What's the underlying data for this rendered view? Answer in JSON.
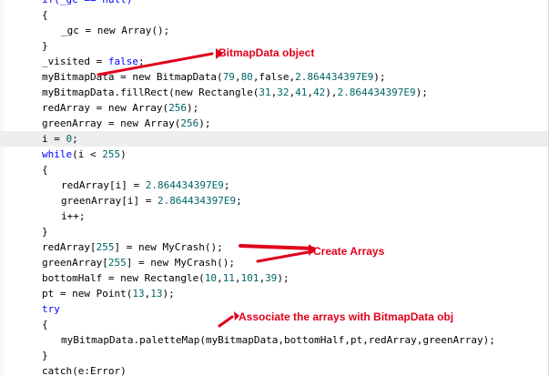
{
  "editor": {
    "lines": [
      {
        "indent": 0,
        "tokens": [
          {
            "t": "if(_gc == null)",
            "c": "kw"
          }
        ]
      },
      {
        "indent": 0,
        "tokens": [
          {
            "t": "{"
          }
        ]
      },
      {
        "indent": 1,
        "tokens": [
          {
            "t": "_gc = new Array();"
          }
        ]
      },
      {
        "indent": 0,
        "tokens": [
          {
            "t": "}"
          }
        ]
      },
      {
        "indent": 0,
        "tokens": [
          {
            "t": "_visited = "
          },
          {
            "t": "false",
            "c": "kw"
          },
          {
            "t": ";"
          }
        ]
      },
      {
        "indent": 0,
        "tokens": [
          {
            "t": "myBitmapData = new BitmapData("
          },
          {
            "t": "79",
            "c": "num"
          },
          {
            "t": ","
          },
          {
            "t": "80",
            "c": "num"
          },
          {
            "t": ",false,"
          },
          {
            "t": "2.864434397E9",
            "c": "num"
          },
          {
            "t": ");"
          }
        ]
      },
      {
        "indent": 0,
        "tokens": [
          {
            "t": "myBitmapData.fillRect(new Rectangle("
          },
          {
            "t": "31",
            "c": "num"
          },
          {
            "t": ","
          },
          {
            "t": "32",
            "c": "num"
          },
          {
            "t": ","
          },
          {
            "t": "41",
            "c": "num"
          },
          {
            "t": ","
          },
          {
            "t": "42",
            "c": "num"
          },
          {
            "t": "),"
          },
          {
            "t": "2.864434397E9",
            "c": "num"
          },
          {
            "t": ");"
          }
        ]
      },
      {
        "indent": 0,
        "tokens": [
          {
            "t": "redArray = new Array("
          },
          {
            "t": "256",
            "c": "num"
          },
          {
            "t": ");"
          }
        ]
      },
      {
        "indent": 0,
        "tokens": [
          {
            "t": "greenArray = new Array("
          },
          {
            "t": "256",
            "c": "num"
          },
          {
            "t": ");"
          }
        ]
      },
      {
        "indent": 0,
        "current": true,
        "tokens": [
          {
            "t": "i = "
          },
          {
            "t": "0",
            "c": "num"
          },
          {
            "t": ";"
          }
        ]
      },
      {
        "indent": 0,
        "tokens": [
          {
            "t": "while",
            "c": "kw"
          },
          {
            "t": "(i < "
          },
          {
            "t": "255",
            "c": "num"
          },
          {
            "t": ")"
          }
        ]
      },
      {
        "indent": 0,
        "tokens": [
          {
            "t": "{"
          }
        ]
      },
      {
        "indent": 1,
        "tokens": [
          {
            "t": "redArray[i] = "
          },
          {
            "t": "2.864434397E9",
            "c": "num"
          },
          {
            "t": ";"
          }
        ]
      },
      {
        "indent": 1,
        "tokens": [
          {
            "t": "greenArray[i] = "
          },
          {
            "t": "2.864434397E9",
            "c": "num"
          },
          {
            "t": ";"
          }
        ]
      },
      {
        "indent": 1,
        "tokens": [
          {
            "t": "i++;"
          }
        ]
      },
      {
        "indent": 0,
        "tokens": [
          {
            "t": "}"
          }
        ]
      },
      {
        "indent": 0,
        "tokens": [
          {
            "t": "redArray["
          },
          {
            "t": "255",
            "c": "num"
          },
          {
            "t": "] = new MyCrash();"
          }
        ]
      },
      {
        "indent": 0,
        "tokens": [
          {
            "t": "greenArray["
          },
          {
            "t": "255",
            "c": "num"
          },
          {
            "t": "] = new MyCrash();"
          }
        ]
      },
      {
        "indent": 0,
        "tokens": [
          {
            "t": "bottomHalf = new Rectangle("
          },
          {
            "t": "10",
            "c": "num"
          },
          {
            "t": ","
          },
          {
            "t": "11",
            "c": "num"
          },
          {
            "t": ","
          },
          {
            "t": "101",
            "c": "num"
          },
          {
            "t": ","
          },
          {
            "t": "39",
            "c": "num"
          },
          {
            "t": ");"
          }
        ]
      },
      {
        "indent": 0,
        "tokens": [
          {
            "t": "pt = new Point("
          },
          {
            "t": "13",
            "c": "num"
          },
          {
            "t": ","
          },
          {
            "t": "13",
            "c": "num"
          },
          {
            "t": ");"
          }
        ]
      },
      {
        "indent": 0,
        "tokens": [
          {
            "t": "try",
            "c": "kw"
          }
        ]
      },
      {
        "indent": 0,
        "tokens": [
          {
            "t": "{"
          }
        ]
      },
      {
        "indent": 1,
        "tokens": [
          {
            "t": "myBitmapData.paletteMap(myBitmapData,bottomHalf,pt,redArray,greenArray);"
          }
        ]
      },
      {
        "indent": 0,
        "tokens": [
          {
            "t": "}"
          }
        ]
      },
      {
        "indent": 0,
        "tokens": [
          {
            "t": "catch(e:Error)"
          }
        ]
      }
    ]
  },
  "annotations": {
    "bitmapdata_label": "BitmapData object",
    "create_arrays_label": "Create Arrays",
    "associate_label": "Associate the arrays with BitmapData obj",
    "color": "#e0001b"
  },
  "colors": {
    "keyword": "#0000ff",
    "number": "#006666",
    "text": "#000000",
    "current_line": "#eeeeee"
  }
}
